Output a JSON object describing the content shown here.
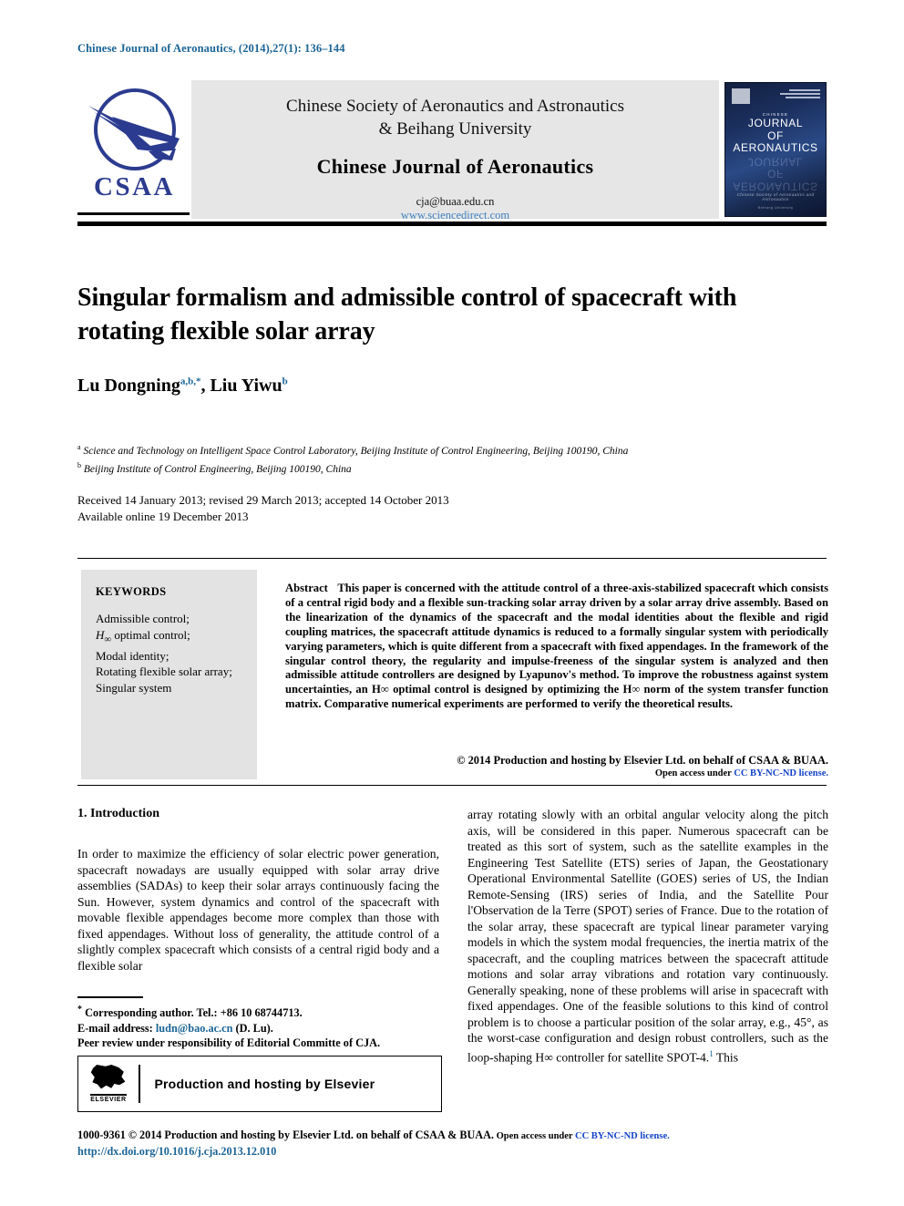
{
  "running_head": "Chinese Journal of Aeronautics, (2014),27(1): 136–144",
  "masthead": {
    "logo_text": "CSAA",
    "society_line1": "Chinese Society of Aeronautics and Astronautics",
    "society_line2": "& Beihang University",
    "journal_name": "Chinese Journal of Aeronautics",
    "email": "cja@buaa.edu.cn",
    "website": "www.sciencedirect.com",
    "cover": {
      "chinese_label": "CHINESE",
      "line1": "JOURNAL",
      "line2": "OF",
      "line3": "AERONAUTICS",
      "footer_italic": "Chinese Society of Aeronautics and Astronautics",
      "footer_small": "Beihang University"
    }
  },
  "article": {
    "title": "Singular formalism and admissible control of spacecraft with rotating flexible solar array",
    "authors": [
      {
        "name": "Lu Dongning",
        "marks": "a,b,*"
      },
      {
        "name": "Liu Yiwu",
        "marks": "b"
      }
    ],
    "affiliations": [
      {
        "label": "a",
        "text": "Science and Technology on Intelligent Space Control Laboratory, Beijing Institute of Control Engineering, Beijing 100190, China"
      },
      {
        "label": "b",
        "text": "Beijing Institute of Control Engineering, Beijing 100190, China"
      }
    ],
    "history_line1": "Received 14 January 2013; revised 29 March 2013; accepted 14 October 2013",
    "history_line2": "Available online 19 December 2013"
  },
  "keywords": {
    "heading": "KEYWORDS",
    "items": [
      "Admissible control;",
      "H∞ optimal control;",
      "Modal identity;",
      "Rotating flexible solar array;",
      "Singular system"
    ]
  },
  "abstract": {
    "label": "Abstract",
    "text": "This paper is concerned with the attitude control of a three-axis-stabilized spacecraft which consists of a central rigid body and a flexible sun-tracking solar array driven by a solar array drive assembly. Based on the linearization of the dynamics of the spacecraft and the modal identities about the flexible and rigid coupling matrices, the spacecraft attitude dynamics is reduced to a formally singular system with periodically varying parameters, which is quite different from a spacecraft with fixed appendages. In the framework of the singular control theory, the regularity and impulse-freeness of the singular system is analyzed and then admissible attitude controllers are designed by Lyapunov's method. To improve the robustness against system uncertainties, an H∞ optimal control is designed by optimizing the H∞ norm of the system transfer function matrix. Comparative numerical experiments are performed to verify the theoretical results.",
    "copyright": "© 2014 Production and hosting by Elsevier Ltd. on behalf of CSAA & BUAA.",
    "open_access_prefix": "Open access under ",
    "open_access_license": "CC BY-NC-ND license."
  },
  "body": {
    "section_heading": "1. Introduction",
    "left_column": "In order to maximize the efficiency of solar electric power generation, spacecraft nowadays are usually equipped with solar array drive assemblies (SADAs) to keep their solar arrays continuously facing the Sun. However, system dynamics and control of the spacecraft with movable flexible appendages become more complex than those with fixed appendages. Without loss of generality, the attitude control of a slightly complex spacecraft which consists of a central rigid body and a flexible solar",
    "right_column_pre": "array rotating slowly with an orbital angular velocity along the pitch axis, will be considered in this paper. Numerous spacecraft can be treated as this sort of system, such as the satellite examples in the Engineering Test Satellite (ETS) series of Japan, the Geostationary Operational Environmental Satellite (GOES) series of US, the Indian Remote-Sensing (IRS) series of India, and the Satellite Pour l'Observation de la Terre (SPOT) series of France. Due to the rotation of the solar array, these spacecraft are typical linear parameter varying models in which the system modal frequencies, the inertia matrix of the spacecraft, and the coupling matrices between the spacecraft attitude motions and solar array vibrations and rotation vary continuously. Generally speaking, none of these problems will arise in spacecraft with fixed appendages. One of the feasible solutions to this kind of control problem is to choose a particular position of the solar array, e.g., 45°, as the worst-case configuration and design robust controllers, such as the loop-shaping H∞ controller for satellite SPOT-4.",
    "right_column_ref": "1",
    "right_column_post": "This"
  },
  "footnotes": {
    "corresponding": "Corresponding author. Tel.: +86 10 68744713.",
    "email_label": "E-mail address: ",
    "email": "ludn@bao.ac.cn",
    "email_suffix": " (D. Lu).",
    "peer_review": "Peer review under responsibility of Editorial Committe of CJA.",
    "elsevier_badge": "Production and hosting by Elsevier",
    "elsevier_wordmark": "ELSEVIER"
  },
  "footer": {
    "issn_copyright": "1000-9361 © 2014 Production and hosting by Elsevier Ltd. on behalf of CSAA & BUAA.",
    "open_access_prefix": " Open access under ",
    "open_access_license": "CC BY-NC-ND license.",
    "doi": "http://dx.doi.org/10.1016/j.cja.2013.12.010"
  },
  "colors": {
    "link_blue": "#1a6496",
    "license_blue": "#1442c8",
    "logo_navy": "#2b3b8f",
    "masthead_gray": "#e6e6e6",
    "keywords_gray": "#e3e3e3"
  }
}
